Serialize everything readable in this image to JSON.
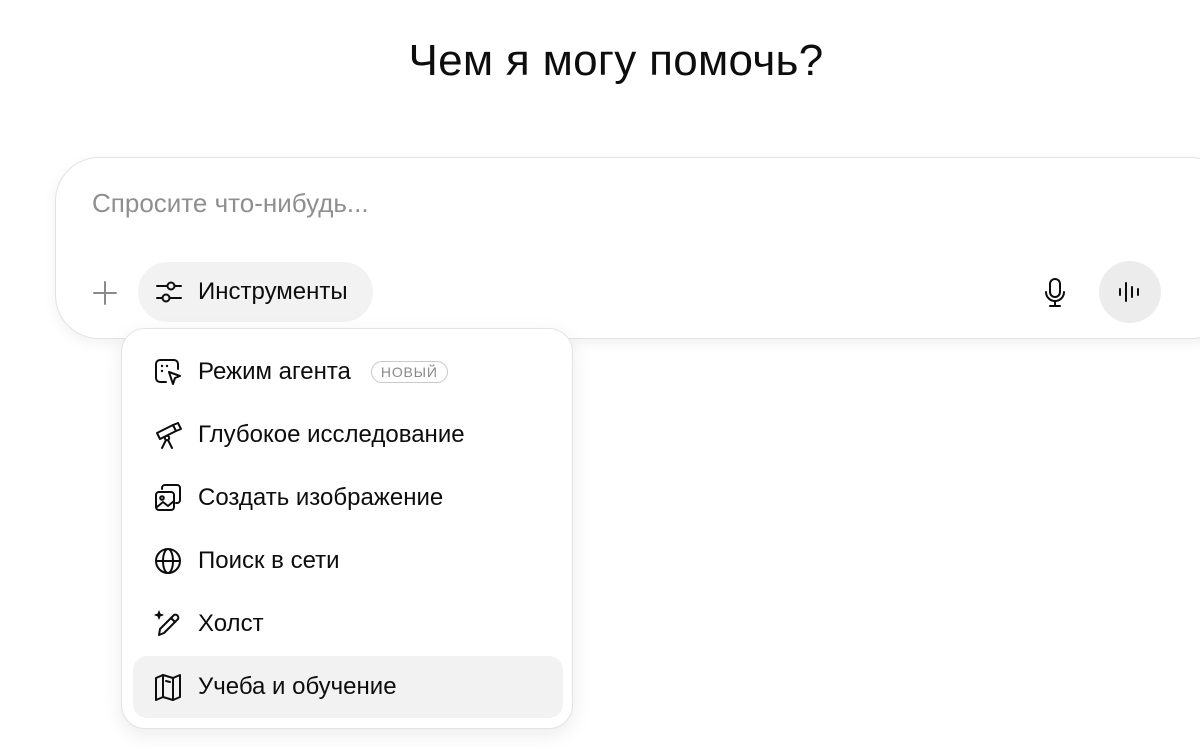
{
  "heading": "Чем я могу помочь?",
  "composer": {
    "placeholder": "Спросите что-нибудь...",
    "value": "",
    "add_icon": "plus-icon",
    "tools_label": "Инструменты",
    "tools_icon": "sliders-icon",
    "mic_icon": "microphone-icon",
    "voice_icon": "voice-waveform-icon"
  },
  "tools_menu": {
    "items": [
      {
        "label": "Режим агента",
        "icon": "agent-cursor-icon",
        "badge": "НОВЫЙ",
        "active": false
      },
      {
        "label": "Глубокое исследование",
        "icon": "telescope-icon",
        "active": false
      },
      {
        "label": "Создать изображение",
        "icon": "image-icon",
        "active": false
      },
      {
        "label": "Поиск в сети",
        "icon": "globe-icon",
        "active": false
      },
      {
        "label": "Холст",
        "icon": "pencil-sparkle-icon",
        "active": false
      },
      {
        "label": "Учеба и обучение",
        "icon": "book-icon",
        "active": true
      }
    ]
  },
  "colors": {
    "text": "#0d0d0d",
    "placeholder": "#8f8f8f",
    "pill_background": "#f2f2f2",
    "voice_button_background": "#ececec",
    "border": "#e3e3e3"
  }
}
